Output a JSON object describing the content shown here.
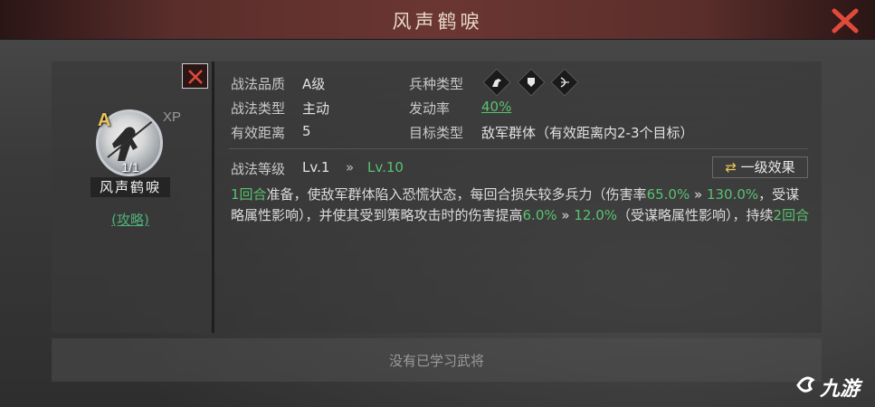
{
  "dialog": {
    "title": "风声鹤唳"
  },
  "skill": {
    "grade": "A",
    "xp_label": "XP",
    "count": "1/1",
    "name": "风声鹤唳",
    "guide_link": "(攻略)"
  },
  "attributes": {
    "quality_label": "战法品质",
    "quality_value": "A级",
    "type_label": "战法类型",
    "type_value": "主动",
    "range_label": "有效距离",
    "range_value": "5",
    "troop_label": "兵种类型",
    "troop_icons": [
      "cavalry-icon",
      "shield-icon",
      "archer-icon"
    ],
    "rate_label": "发动率",
    "rate_value": "40%",
    "target_label": "目标类型",
    "target_value": "敌军群体（有效距离内2-3个目标）"
  },
  "level": {
    "label": "战法等级",
    "from": "Lv.1",
    "arrow": "»",
    "to": "Lv.10",
    "effect_button": "一级效果"
  },
  "description": {
    "p1_green": "1回合",
    "p1_text": "准备，使敌军群体陷入恐慌状态，每回合损失较多兵力（伤害率",
    "p1_v1": "65.0%",
    "arrow": "»",
    "p1_v2": "130.0%",
    "p2_text": "，受谋略属性影响），并使其受到策略攻击时的伤害提高",
    "p2_v1": "6.0%",
    "p2_v2": "12.0%",
    "p3_text": "（受谋略属性影响），持续",
    "p3_green": "2回合"
  },
  "footer": {
    "no_general_text": "没有已学习武将"
  },
  "watermark": {
    "text": "九游"
  },
  "colors": {
    "accent_green": "#59c26f",
    "title_bar": "#6b3632",
    "close_red": "#e04a3a"
  }
}
